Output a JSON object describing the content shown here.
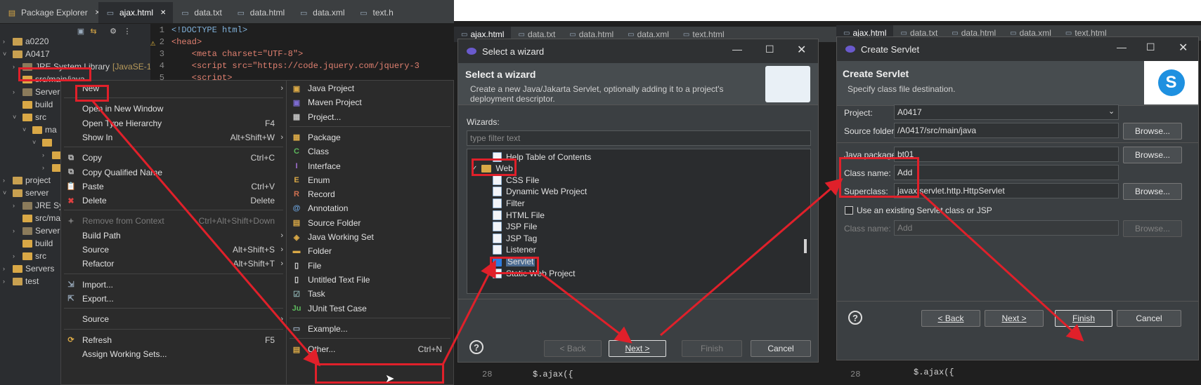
{
  "left_panel": {
    "tabs": [
      "Package Explorer",
      "ajax.html",
      "data.txt",
      "data.html",
      "data.xml",
      "text.h"
    ],
    "tree": [
      {
        "label": "a0220",
        "indent": 0,
        "arrow": "›",
        "kind": "project"
      },
      {
        "label": "A0417",
        "indent": 0,
        "arrow": "˅",
        "kind": "project"
      },
      {
        "label": "JRE System Library",
        "suffix": "[JavaSE-17",
        "indent": 1,
        "arrow": "›",
        "kind": "jar"
      },
      {
        "label": "src/main/java",
        "indent": 1,
        "arrow": "",
        "kind": "folder"
      },
      {
        "label": "Server",
        "indent": 1,
        "arrow": "›",
        "kind": "jar"
      },
      {
        "label": "build",
        "indent": 1,
        "arrow": "",
        "kind": "folder"
      },
      {
        "label": "src",
        "indent": 1,
        "arrow": "˅",
        "kind": "folder"
      },
      {
        "label": "ma",
        "indent": 2,
        "arrow": "˅",
        "kind": "folder"
      },
      {
        "label": "",
        "indent": 3,
        "arrow": "˅",
        "kind": "folder"
      },
      {
        "label": "",
        "indent": 4,
        "arrow": "›",
        "kind": "folder"
      },
      {
        "label": "",
        "indent": 4,
        "arrow": "›",
        "kind": "folder"
      },
      {
        "label": "project",
        "indent": 0,
        "arrow": "›",
        "kind": "project"
      },
      {
        "label": "server",
        "indent": 0,
        "arrow": "˅",
        "kind": "project"
      },
      {
        "label": "JRE Sys",
        "indent": 1,
        "arrow": "›",
        "kind": "jar"
      },
      {
        "label": "src/ma",
        "indent": 1,
        "arrow": "",
        "kind": "folder"
      },
      {
        "label": "Server",
        "indent": 1,
        "arrow": "›",
        "kind": "jar"
      },
      {
        "label": "build",
        "indent": 1,
        "arrow": "",
        "kind": "folder"
      },
      {
        "label": "src",
        "indent": 1,
        "arrow": "›",
        "kind": "folder"
      },
      {
        "label": "Servers",
        "indent": 0,
        "arrow": "›",
        "kind": "folder"
      },
      {
        "label": "test",
        "indent": 0,
        "arrow": "›",
        "kind": "project"
      }
    ],
    "code_lines": [
      {
        "num": "1",
        "text": "<!DOCTYPE html>"
      },
      {
        "num": "2",
        "text": "<head>"
      },
      {
        "num": "3",
        "text": "    <meta charset=\"UTF-8\">"
      },
      {
        "num": "4",
        "text": "    <script src=\"https://code.jquery.com/jquery-3"
      },
      {
        "num": "5",
        "text": "    <script>"
      }
    ]
  },
  "context_menu": {
    "items": [
      {
        "label": "New",
        "shortcut": "",
        "submenu": true,
        "icon": "",
        "disabled": false
      },
      {
        "sep": true
      },
      {
        "label": "Open in New Window",
        "shortcut": "",
        "submenu": false,
        "icon": "",
        "disabled": false
      },
      {
        "label": "Open Type Hierarchy",
        "shortcut": "F4",
        "submenu": false,
        "icon": "",
        "disabled": false
      },
      {
        "label": "Show In",
        "shortcut": "Alt+Shift+W",
        "submenu": true,
        "icon": "",
        "disabled": false
      },
      {
        "sep": true
      },
      {
        "label": "Copy",
        "shortcut": "Ctrl+C",
        "submenu": false,
        "icon": "copy-icon",
        "disabled": false
      },
      {
        "label": "Copy Qualified Name",
        "shortcut": "",
        "submenu": false,
        "icon": "copy-icon",
        "disabled": false
      },
      {
        "label": "Paste",
        "shortcut": "Ctrl+V",
        "submenu": false,
        "icon": "paste-icon",
        "disabled": false
      },
      {
        "label": "Delete",
        "shortcut": "Delete",
        "submenu": false,
        "icon": "delete-icon",
        "disabled": false
      },
      {
        "sep": true
      },
      {
        "label": "Remove from Context",
        "shortcut": "Ctrl+Alt+Shift+Down",
        "submenu": false,
        "icon": "remove-context-icon",
        "disabled": true
      },
      {
        "label": "Build Path",
        "shortcut": "",
        "submenu": true,
        "icon": "",
        "disabled": false
      },
      {
        "label": "Source",
        "shortcut": "Alt+Shift+S",
        "submenu": true,
        "icon": "",
        "disabled": false
      },
      {
        "label": "Refactor",
        "shortcut": "Alt+Shift+T",
        "submenu": true,
        "icon": "",
        "disabled": false
      },
      {
        "sep": true
      },
      {
        "label": "Import...",
        "shortcut": "",
        "submenu": false,
        "icon": "import-icon",
        "disabled": false
      },
      {
        "label": "Export...",
        "shortcut": "",
        "submenu": false,
        "icon": "export-icon",
        "disabled": false
      },
      {
        "sep": true
      },
      {
        "label": "Source",
        "shortcut": "",
        "submenu": true,
        "icon": "",
        "disabled": false
      },
      {
        "sep": true
      },
      {
        "label": "Refresh",
        "shortcut": "F5",
        "submenu": false,
        "icon": "refresh-icon",
        "disabled": false
      },
      {
        "label": "Assign Working Sets...",
        "shortcut": "",
        "submenu": false,
        "icon": "",
        "disabled": false
      }
    ]
  },
  "new_submenu": {
    "items": [
      {
        "label": "Java Project",
        "icon": "java-project-icon"
      },
      {
        "label": "Maven Project",
        "icon": "maven-project-icon"
      },
      {
        "label": "Project...",
        "icon": "project-icon"
      },
      {
        "sep": true
      },
      {
        "label": "Package",
        "icon": "package-icon"
      },
      {
        "label": "Class",
        "icon": "class-icon"
      },
      {
        "label": "Interface",
        "icon": "interface-icon"
      },
      {
        "label": "Enum",
        "icon": "enum-icon"
      },
      {
        "label": "Record",
        "icon": "record-icon"
      },
      {
        "label": "Annotation",
        "icon": "annotation-icon"
      },
      {
        "label": "Source Folder",
        "icon": "source-folder-icon"
      },
      {
        "label": "Java Working Set",
        "icon": "working-set-icon"
      },
      {
        "label": "Folder",
        "icon": "folder-icon"
      },
      {
        "label": "File",
        "icon": "file-icon"
      },
      {
        "label": "Untitled Text File",
        "icon": "text-file-icon"
      },
      {
        "label": "Task",
        "icon": "task-icon"
      },
      {
        "label": "JUnit Test Case",
        "icon": "junit-icon"
      },
      {
        "sep": true
      },
      {
        "label": "Example...",
        "icon": "example-icon"
      },
      {
        "sep": true
      },
      {
        "label": "Other...",
        "icon": "other-icon",
        "shortcut": "Ctrl+N"
      }
    ]
  },
  "wizard_dialog": {
    "title": "Select a wizard",
    "banner_title": "Select a wizard",
    "banner_desc": "Create a new Java/Jakarta Servlet, optionally adding it to a project's deployment descriptor.",
    "wizards_label": "Wizards:",
    "filter_placeholder": "type filter text",
    "bg_tabs": [
      "ajax.html",
      "data.txt",
      "data.html",
      "data.xml",
      "text.html"
    ],
    "items": [
      {
        "label": "Help Table of Contents",
        "indent": 2
      },
      {
        "label": "Web",
        "indent": 0,
        "expanded": true
      },
      {
        "label": "CSS File",
        "indent": 2
      },
      {
        "label": "Dynamic Web Project",
        "indent": 2
      },
      {
        "label": "Filter",
        "indent": 2
      },
      {
        "label": "HTML File",
        "indent": 2
      },
      {
        "label": "JSP File",
        "indent": 2
      },
      {
        "label": "JSP Tag",
        "indent": 2
      },
      {
        "label": "Listener",
        "indent": 2
      },
      {
        "label": "Servlet",
        "indent": 2,
        "selected": true
      },
      {
        "label": "Static Web Project",
        "indent": 2
      }
    ],
    "buttons": {
      "back": "< Back",
      "next": "Next >",
      "finish": "Finish",
      "cancel": "Cancel"
    },
    "code_bottom": "$.ajax({",
    "line_no": "28"
  },
  "servlet_dialog": {
    "title": "Create Servlet",
    "banner_title": "Create Servlet",
    "banner_desc": "Specify class file destination.",
    "bg_tabs": [
      "ajax.html",
      "data.txt",
      "data.html",
      "data.xml",
      "text.html"
    ],
    "project_label": "Project:",
    "project_value": "A0417",
    "source_folder_label": "Source folder:",
    "source_folder_value": "/A0417/src/main/java",
    "java_package_label": "Java package:",
    "java_package_value": "bt01",
    "class_name_label": "Class name:",
    "class_name_value": "Add",
    "superclass_label": "Superclass:",
    "superclass_value": "javax.servlet.http.HttpServlet",
    "use_existing_label": "Use an existing Servlet class or JSP",
    "class_name2_label": "Class name:",
    "class_name2_value": "Add",
    "browse": "Browse...",
    "buttons": {
      "back": "< Back",
      "next": "Next >",
      "finish": "Finish",
      "cancel": "Cancel"
    },
    "code_bottom": "$.ajax({",
    "line_no": "28"
  },
  "colors": {
    "highlight": "#e0202a",
    "dark_bg": "#2b2d30",
    "dialog_bg": "#3b3f42"
  }
}
